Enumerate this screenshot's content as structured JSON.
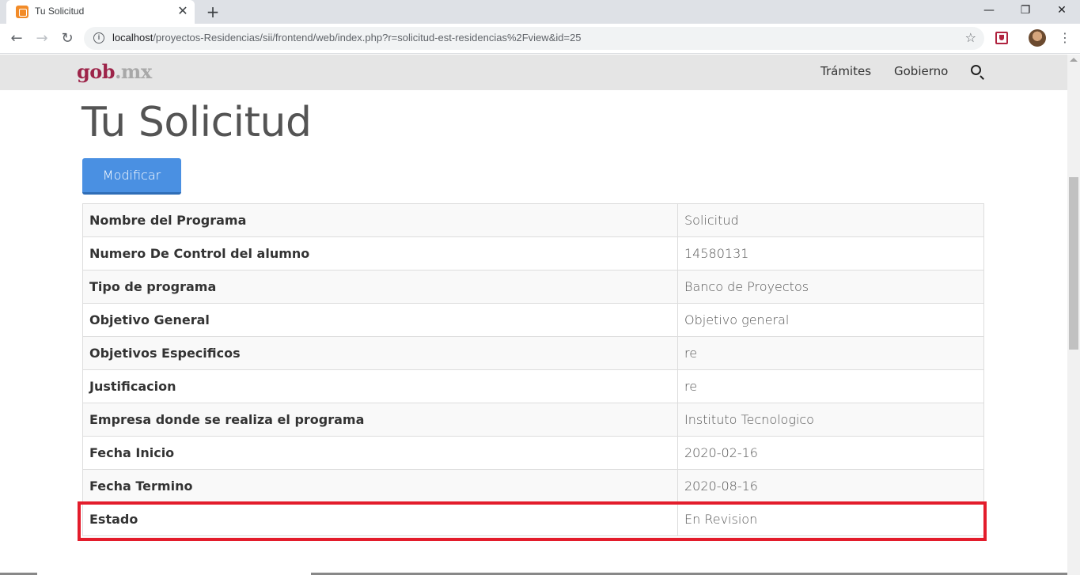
{
  "browser": {
    "tab_title": "Tu Solicitud",
    "tab_close": "✕",
    "new_tab": "+",
    "url_host": "localhost",
    "url_path": "/proyectos-Residencias/sii/frontend/web/index.php?r=solicitud-est-residencias%2Fview&id=25",
    "window_controls": {
      "minimize": "—",
      "restore": "❐",
      "close": "✕"
    }
  },
  "site_nav": {
    "logo_main": "gob",
    "logo_suffix": ".mx",
    "links": [
      "Trámites",
      "Gobierno"
    ]
  },
  "page": {
    "title": "Tu Solicitud",
    "button_label": "Modificar"
  },
  "details": [
    {
      "label": "Nombre del Programa",
      "value": "Solicitud"
    },
    {
      "label": "Numero De Control del alumno",
      "value": "14580131"
    },
    {
      "label": "Tipo de programa",
      "value": "Banco de Proyectos"
    },
    {
      "label": "Objetivo General",
      "value": "Objetivo general"
    },
    {
      "label": "Objetivos Especificos",
      "value": "re"
    },
    {
      "label": "Justificacion",
      "value": "re"
    },
    {
      "label": "Empresa donde se realiza el programa",
      "value": "Instituto Tecnologico"
    },
    {
      "label": "Fecha Inicio",
      "value": "2020-02-16"
    },
    {
      "label": "Fecha Termino",
      "value": "2020-08-16"
    },
    {
      "label": "Estado",
      "value": "En Revision"
    }
  ],
  "colors": {
    "brand": "#9d2449",
    "button": "#4a90e2",
    "highlight": "#e31c2b"
  }
}
